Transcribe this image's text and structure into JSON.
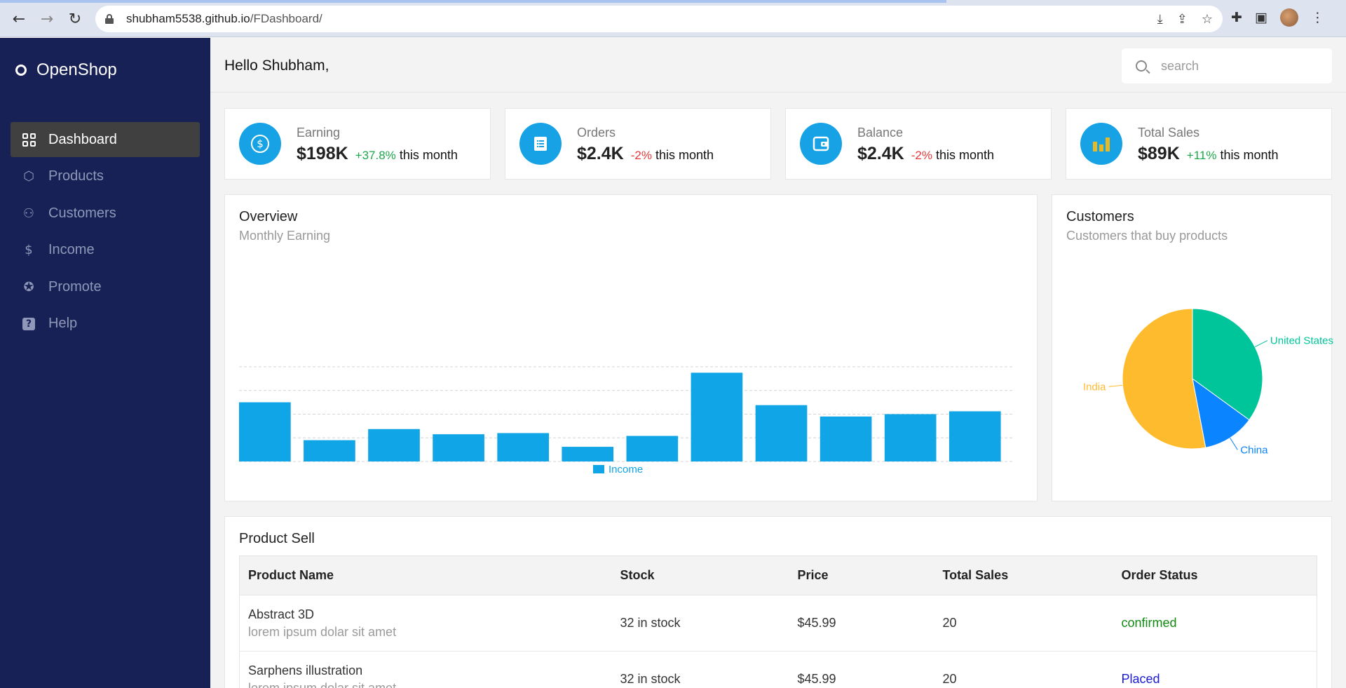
{
  "browser": {
    "url_host": "shubham5538.github.io",
    "url_path": "/FDashboard/"
  },
  "sidebar": {
    "brand": "OpenShop",
    "items": [
      {
        "label": "Dashboard",
        "icon": "grid-icon",
        "active": true
      },
      {
        "label": "Products",
        "icon": "box-icon",
        "active": false
      },
      {
        "label": "Customers",
        "icon": "users-icon",
        "active": false
      },
      {
        "label": "Income",
        "icon": "dollar-icon",
        "active": false
      },
      {
        "label": "Promote",
        "icon": "badge-percent-icon",
        "active": false
      },
      {
        "label": "Help",
        "icon": "help-icon",
        "active": false
      }
    ]
  },
  "header": {
    "greeting": "Hello Shubham,",
    "search_placeholder": "search"
  },
  "stats": [
    {
      "label": "Earning",
      "value": "$198K",
      "change": "+37.8%",
      "trend": "up",
      "period": "this month",
      "icon": "dollar-circle-icon"
    },
    {
      "label": "Orders",
      "value": "$2.4K",
      "change": "-2%",
      "trend": "down",
      "period": "this month",
      "icon": "list-icon"
    },
    {
      "label": "Balance",
      "value": "$2.4K",
      "change": "-2%",
      "trend": "down",
      "period": "this month",
      "icon": "wallet-icon"
    },
    {
      "label": "Total Sales",
      "value": "$89K",
      "change": "+11%",
      "trend": "up",
      "period": "this month",
      "icon": "bar-chart-icon"
    }
  ],
  "overview": {
    "title": "Overview",
    "subtitle": "Monthly Earning"
  },
  "customers": {
    "title": "Customers",
    "subtitle": "Customers that buy products"
  },
  "chart_data": [
    {
      "type": "bar",
      "title": "",
      "categories": [
        "",
        "",
        "",
        "",
        "",
        "",
        "",
        "",
        "",
        "",
        "",
        ""
      ],
      "series": [
        {
          "name": "Income",
          "color": "#10a5e6",
          "values": [
            2500,
            900,
            1370,
            1150,
            1200,
            620,
            1080,
            3750,
            2380,
            1900,
            2000,
            2120
          ]
        }
      ],
      "ylim": [
        0,
        4000
      ],
      "grid": true,
      "legend": "bottom"
    },
    {
      "type": "pie",
      "labels": [
        "United States",
        "China",
        "India"
      ],
      "values": [
        35,
        12,
        53
      ],
      "colors": [
        "#00c49a",
        "#0a84ff",
        "#ffbb2e"
      ]
    }
  ],
  "product_sell": {
    "title": "Product Sell",
    "columns": [
      "Product Name",
      "Stock",
      "Price",
      "Total Sales",
      "Order Status"
    ],
    "rows": [
      {
        "name": "Abstract 3D",
        "desc": "lorem ipsum dolar sit amet",
        "stock": "32 in stock",
        "price": "$45.99",
        "sales": "20",
        "status": "confirmed"
      },
      {
        "name": "Sarphens illustration",
        "desc": "lorem ipsum dolar sit amet",
        "stock": "32 in stock",
        "price": "$45.99",
        "sales": "20",
        "status": "Placed"
      }
    ]
  }
}
